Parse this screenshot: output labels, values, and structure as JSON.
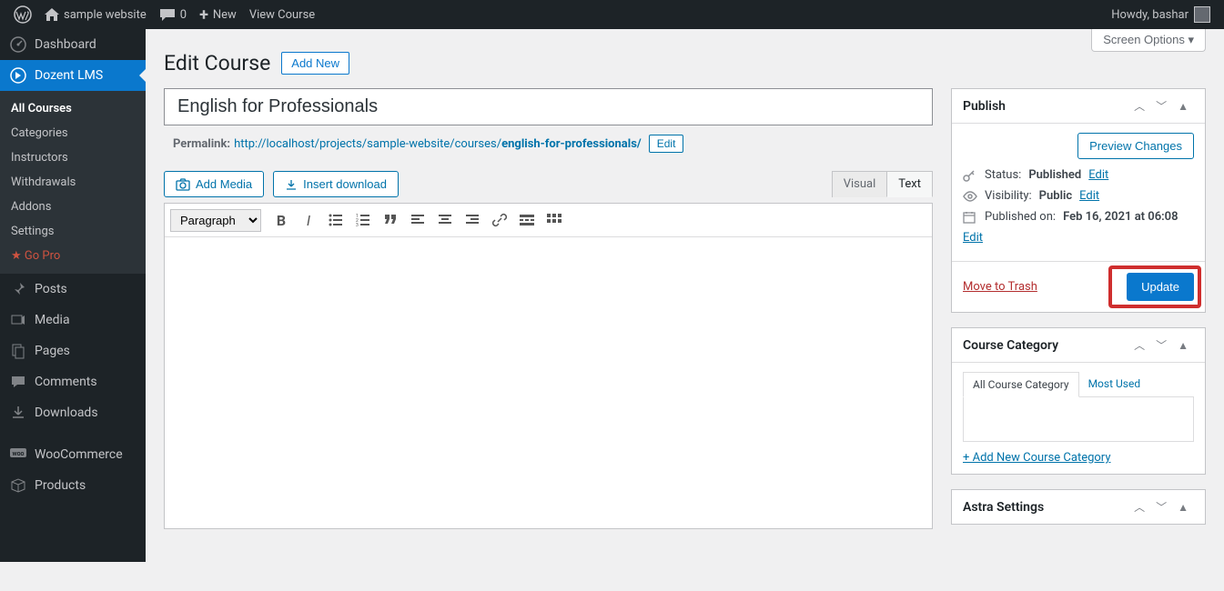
{
  "adminbar": {
    "site_name": "sample website",
    "comments_count": "0",
    "new_label": "New",
    "view_label": "View Course",
    "howdy": "Howdy, bashar"
  },
  "sidebar": {
    "dashboard": "Dashboard",
    "dozent": "Dozent LMS",
    "submenu": {
      "all_courses": "All Courses",
      "categories": "Categories",
      "instructors": "Instructors",
      "withdrawals": "Withdrawals",
      "addons": "Addons",
      "settings": "Settings",
      "go_pro": "Go Pro"
    },
    "posts": "Posts",
    "media": "Media",
    "pages": "Pages",
    "comments": "Comments",
    "downloads": "Downloads",
    "woocommerce": "WooCommerce",
    "products": "Products"
  },
  "screen_options": "Screen Options ▾",
  "heading": "Edit Course",
  "add_new": "Add New",
  "title_value": "English for Professionals",
  "permalink_label": "Permalink:",
  "permalink_base": "http://localhost/projects/sample-website/courses/",
  "permalink_slug": "english-for-professionals/",
  "edit_slug": "Edit",
  "editor": {
    "add_media": "Add Media",
    "insert_download": "Insert download",
    "visual_tab": "Visual",
    "text_tab": "Text",
    "format_select": "Paragraph"
  },
  "publish_box": {
    "title": "Publish",
    "preview_changes": "Preview Changes",
    "status_label": "Status:",
    "status_value": "Published",
    "status_edit": "Edit",
    "visibility_label": "Visibility:",
    "visibility_value": "Public",
    "visibility_edit": "Edit",
    "published_label": "Published on:",
    "published_value": "Feb 16, 2021 at 06:08",
    "published_edit": "Edit",
    "move_to_trash": "Move to Trash",
    "update": "Update"
  },
  "category_box": {
    "title": "Course Category",
    "tab_all": "All Course Category",
    "tab_most": "Most Used",
    "add_new": "+ Add New Course Category"
  },
  "astra_box": {
    "title": "Astra Settings"
  }
}
